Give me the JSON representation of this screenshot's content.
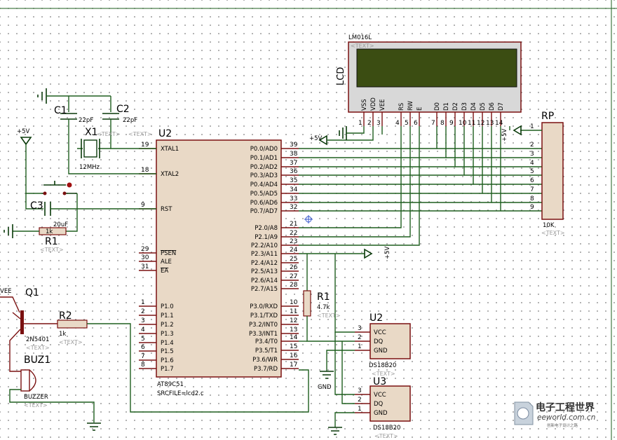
{
  "lcd": {
    "model": "LM016L",
    "text_tag": "<TEXT>",
    "label": "LCD",
    "pins": [
      "VSS",
      "VDD",
      "VEE",
      "RS",
      "RW",
      "E",
      "D0",
      "D1",
      "D2",
      "D3",
      "D4",
      "D5",
      "D6",
      "D7"
    ],
    "pin_numbers": [
      "1",
      "2",
      "3",
      "4",
      "5",
      "6",
      "7",
      "8",
      "9",
      "10",
      "11",
      "12",
      "13",
      "14"
    ]
  },
  "mcu": {
    "ref": "U2",
    "text_tag": "<TEXT>",
    "model": "AT89C51",
    "srcfile": "SRCFILE=lcd2.c",
    "left_pins": [
      {
        "num": "19",
        "name": "XTAL1"
      },
      {
        "num": "18",
        "name": "XTAL2"
      },
      {
        "num": "9",
        "name": "RST"
      },
      {
        "num": "29",
        "name": "PSEN"
      },
      {
        "num": "30",
        "name": "ALE"
      },
      {
        "num": "31",
        "name": "EA"
      },
      {
        "num": "1",
        "name": "P1.0"
      },
      {
        "num": "2",
        "name": "P1.1"
      },
      {
        "num": "3",
        "name": "P1.2"
      },
      {
        "num": "4",
        "name": "P1.3"
      },
      {
        "num": "5",
        "name": "P1.4"
      },
      {
        "num": "6",
        "name": "P1.5"
      },
      {
        "num": "7",
        "name": "P1.6"
      },
      {
        "num": "8",
        "name": "P1.7"
      }
    ],
    "right_pins": [
      {
        "num": "39",
        "name": "P0.0/AD0"
      },
      {
        "num": "38",
        "name": "P0.1/AD1"
      },
      {
        "num": "37",
        "name": "P0.2/AD2"
      },
      {
        "num": "36",
        "name": "P0.3/AD3"
      },
      {
        "num": "35",
        "name": "P0.4/AD4"
      },
      {
        "num": "34",
        "name": "P0.5/AD5"
      },
      {
        "num": "33",
        "name": "P0.6/AD6"
      },
      {
        "num": "32",
        "name": "P0.7/AD7"
      },
      {
        "num": "21",
        "name": "P2.0/A8"
      },
      {
        "num": "22",
        "name": "P2.1/A9"
      },
      {
        "num": "23",
        "name": "P2.2/A10"
      },
      {
        "num": "24",
        "name": "P2.3/A11"
      },
      {
        "num": "25",
        "name": "P2.4/A12"
      },
      {
        "num": "26",
        "name": "P2.5/A13"
      },
      {
        "num": "27",
        "name": "P2.6/A14"
      },
      {
        "num": "28",
        "name": "P2.7/A15"
      },
      {
        "num": "10",
        "name": "P3.0/RXD"
      },
      {
        "num": "11",
        "name": "P3.1/TXD"
      },
      {
        "num": "12",
        "name": "P3.2/INT0"
      },
      {
        "num": "13",
        "name": "P3.3/INT1"
      },
      {
        "num": "14",
        "name": "P3.4/T0"
      },
      {
        "num": "15",
        "name": "P3.5/T1"
      },
      {
        "num": "16",
        "name": "P3.6/WR"
      },
      {
        "num": "17",
        "name": "P3.7/RD"
      }
    ]
  },
  "caps": {
    "c1": "C1",
    "c1_val": "22pF",
    "c2": "C2",
    "c2_val": "22pF",
    "c3": "C3",
    "c3_val": "20uF"
  },
  "crystal": {
    "ref": "X1",
    "value": "12MHz",
    "text_tag": "<TEXT>"
  },
  "resistors": {
    "r1_left": "R1",
    "r1_left_val": "1k",
    "r1_left_tag": "<TEXT>",
    "r2": "R2",
    "r2_val": "1k",
    "r2_tag": "<TEXT>",
    "r1_right": "R1",
    "r1_right_val": "4.7k",
    "r1_right_tag": "<TEXT>"
  },
  "rp": {
    "ref": "RP",
    "value": "10K",
    "text_tag": "<TEXT>",
    "pins": [
      "1",
      "2",
      "3",
      "4",
      "5",
      "6",
      "7",
      "8",
      "9"
    ]
  },
  "power": {
    "vcc_a": "+5V",
    "vcc_b": "+5V",
    "vcc_c": "+5V",
    "vcc_d": "+5V",
    "vcc_e": "+5V",
    "vee": "VEE",
    "gnd": "GND"
  },
  "transistor": {
    "ref": "Q1",
    "model": "2N5401",
    "text_tag": "<TEXT>"
  },
  "buzzer": {
    "ref": "BUZ1",
    "model": "BUZZER",
    "text_tag": "<TEXT>"
  },
  "sensor1": {
    "ref": "U2",
    "model": "DS18B20",
    "text_tag": "<TEXT>",
    "pins": [
      {
        "num": "3",
        "name": "VCC"
      },
      {
        "num": "2",
        "name": "DQ"
      },
      {
        "num": "1",
        "name": "GND"
      }
    ]
  },
  "sensor2": {
    "ref": "U3",
    "model": "DS18B20",
    "text_tag": "<TEXT>",
    "pins": [
      {
        "num": "3",
        "name": "VCC"
      },
      {
        "num": "2",
        "name": "DQ"
      },
      {
        "num": "1",
        "name": "GND"
      }
    ]
  },
  "watermark": {
    "name": "电子工程世界",
    "url": "eeworld.com.cn",
    "slogan": "创新电子设计之路"
  },
  "colors": {
    "wire": "#1e5e1e",
    "pin": "#7a1010",
    "body": "#e9d9c6",
    "lcd_screen": "#3b4d12"
  }
}
